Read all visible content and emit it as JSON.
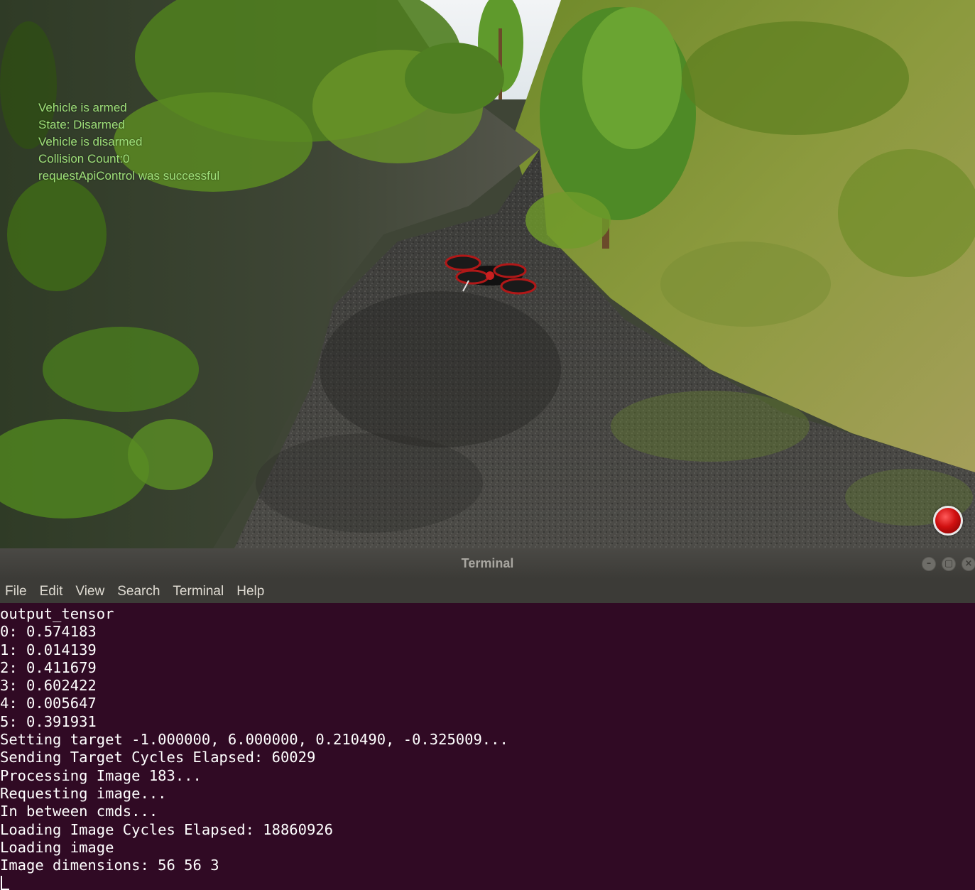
{
  "simulator": {
    "hud_lines": [
      "Vehicle is armed",
      "State: Disarmed",
      "Vehicle is disarmed",
      "Collision Count:0",
      "requestApiControl was successful"
    ],
    "record_button_icon": "record-icon",
    "record_color": "#d01010"
  },
  "terminal": {
    "title": "Terminal",
    "window_buttons": [
      "minimize-icon",
      "maximize-icon",
      "close-icon"
    ],
    "menu": [
      "File",
      "Edit",
      "View",
      "Search",
      "Terminal",
      "Help"
    ],
    "background": "#300a24",
    "lines": [
      "output_tensor",
      "0: 0.574183",
      "1: 0.014139",
      "2: 0.411679",
      "3: 0.602422",
      "4: 0.005647",
      "5: 0.391931",
      "Setting target -1.000000, 6.000000, 0.210490, -0.325009...",
      "Sending Target Cycles Elapsed: 60029",
      "Processing Image 183...",
      "Requesting image...",
      "In between cmds...",
      "Loading Image Cycles Elapsed: 18860926",
      "Loading image",
      "Image dimensions: 56 56 3"
    ]
  }
}
